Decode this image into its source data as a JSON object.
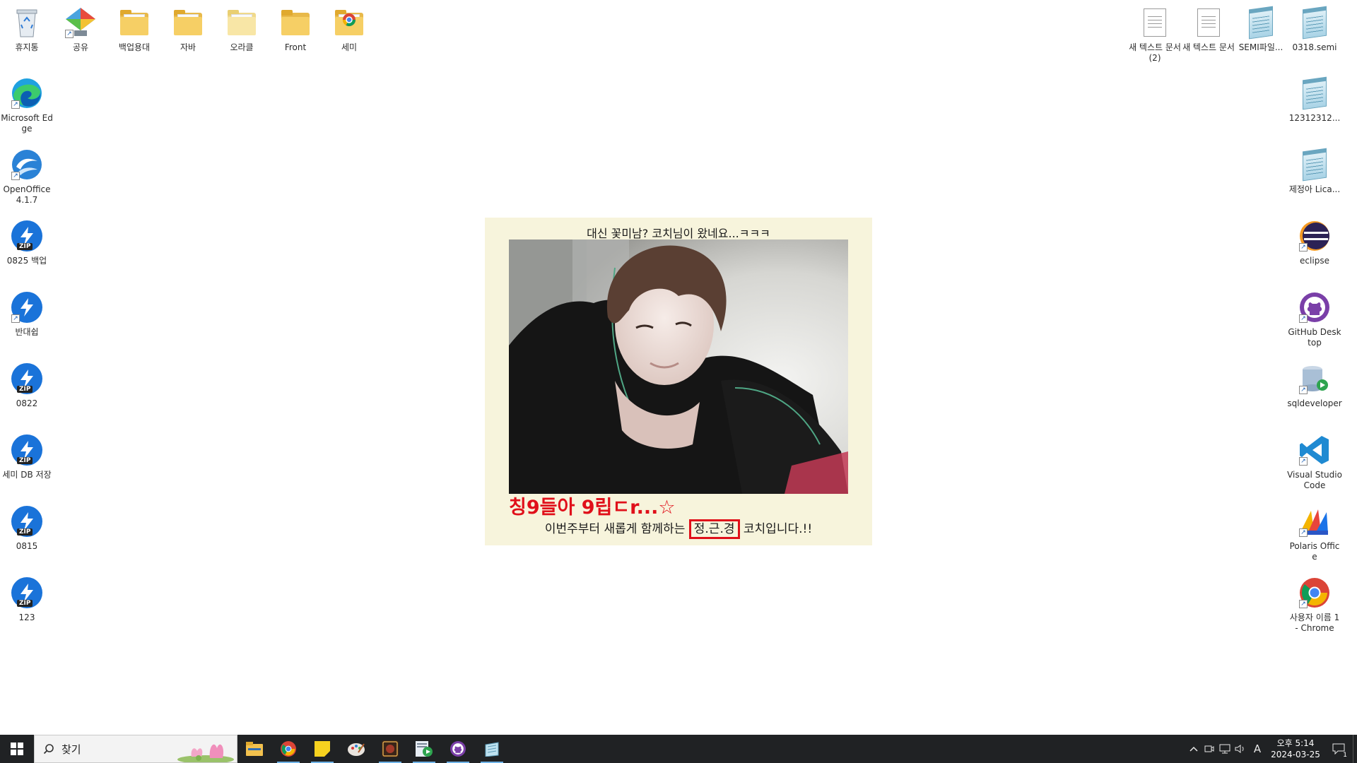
{
  "desktop": {
    "top_row": [
      {
        "label": "휴지통",
        "icon": "recycle-bin-icon"
      },
      {
        "label": "공유",
        "icon": "network-share-icon"
      },
      {
        "label": "백업용대",
        "icon": "folder-icon"
      },
      {
        "label": "자바",
        "icon": "folder-icon"
      },
      {
        "label": "오라클",
        "icon": "folder-icon"
      },
      {
        "label": "Front",
        "icon": "folder-icon"
      },
      {
        "label": "세미",
        "icon": "folder-icon"
      }
    ],
    "left_column": [
      {
        "label": "Microsoft Edge",
        "icon": "edge-icon"
      },
      {
        "label": "OpenOffice 4.1.7",
        "icon": "openoffice-icon"
      },
      {
        "label": "0825 백업",
        "icon": "zip-icon"
      },
      {
        "label": "반대쉽",
        "icon": "bandizip-icon"
      },
      {
        "label": "0822",
        "icon": "zip-icon"
      },
      {
        "label": "세미 DB 저장",
        "icon": "zip-icon"
      },
      {
        "label": "0815",
        "icon": "zip-icon"
      },
      {
        "label": "123",
        "icon": "zip-icon"
      }
    ],
    "top_right_row": [
      {
        "label": "새 텍스트 문서 (2)",
        "icon": "text-document-icon"
      },
      {
        "label": "새 텍스트 문서",
        "icon": "text-document-icon"
      },
      {
        "label": "SEMI파일...",
        "icon": "notepad-icon"
      },
      {
        "label": "0318.semi",
        "icon": "notepad-icon"
      }
    ],
    "right_column": [
      {
        "label": "12312312...",
        "icon": "notepad-icon"
      },
      {
        "label": "제정아 Lica...",
        "icon": "notepad-icon"
      },
      {
        "label": "eclipse",
        "icon": "eclipse-icon"
      },
      {
        "label": "GitHub Desktop",
        "icon": "github-icon"
      },
      {
        "label": "sqldeveloper",
        "icon": "sqldeveloper-icon"
      },
      {
        "label": "Visual Studio Code",
        "icon": "vscode-icon"
      },
      {
        "label": "Polaris Office",
        "icon": "polaris-office-icon"
      },
      {
        "label": "사용자 이름 1 - Chrome",
        "icon": "chrome-icon"
      }
    ]
  },
  "card": {
    "caption": "대신 꽃미남? 코치님이 왔네요...ㅋㅋㅋ",
    "headline": "칭9들아 9립ㄷr...☆",
    "subline_before": "이번주부터 새롭게 함께하는",
    "subline_highlight": "정.근.경",
    "subline_after": "코치입니다.!!",
    "highlight_color": "#e0101a"
  },
  "taskbar": {
    "search_placeholder": "찾기",
    "apps": [
      {
        "name": "file-explorer",
        "icon": "file-explorer-icon",
        "active": false
      },
      {
        "name": "chrome",
        "icon": "chrome-icon",
        "active": true
      },
      {
        "name": "sticky-notes",
        "icon": "sticky-notes-icon",
        "active": true
      },
      {
        "name": "paint",
        "icon": "paint-icon",
        "active": false
      },
      {
        "name": "game",
        "icon": "game-icon",
        "active": true
      },
      {
        "name": "media",
        "icon": "media-player-icon",
        "active": true
      },
      {
        "name": "github",
        "icon": "github-icon",
        "active": true
      },
      {
        "name": "notepad",
        "icon": "notepad-icon",
        "active": true
      }
    ],
    "tray": {
      "ime": "A",
      "time": "오후 5:14",
      "date": "2024-03-25",
      "notification_count": "1"
    }
  }
}
